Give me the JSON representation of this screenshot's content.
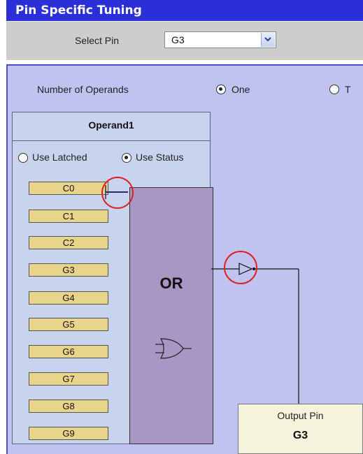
{
  "title": "Pin Specific Tuning",
  "select_pin": {
    "label": "Select Pin",
    "value": "G3"
  },
  "operands": {
    "label": "Number of Operands",
    "option_one": "One",
    "option_two_partial": "T",
    "selected": "One"
  },
  "operand1": {
    "title": "Operand1",
    "use_latched": "Use Latched",
    "use_status": "Use Status",
    "selected": "Use Status",
    "pins": [
      "C0",
      "C1",
      "C2",
      "G3",
      "G4",
      "G5",
      "G6",
      "G7",
      "G8",
      "G9"
    ],
    "connected_pin": "C0"
  },
  "gate": {
    "label": "OR"
  },
  "output": {
    "label": "Output Pin",
    "value": "G3"
  },
  "colors": {
    "title_bar": "#2a2fd8",
    "panel": "#c0c2f0",
    "pin_button": "#e8d48a",
    "or_block": "#a897c5",
    "highlight_circle": "#e02020"
  }
}
